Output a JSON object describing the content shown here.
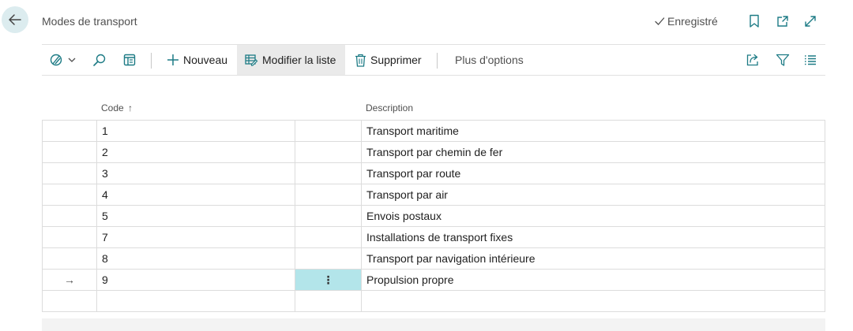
{
  "header": {
    "page_title": "Modes de transport",
    "saved_status": "Enregistré"
  },
  "actionbar": {
    "new_label": "Nouveau",
    "edit_list_label": "Modifier la liste",
    "delete_label": "Supprimer",
    "more_options_label": "Plus d'options"
  },
  "columns": {
    "code": "Code",
    "code_sort_indicator": "↑",
    "description": "Description"
  },
  "rows": [
    {
      "code": "1",
      "description": "Transport maritime"
    },
    {
      "code": "2",
      "description": "Transport par chemin de fer"
    },
    {
      "code": "3",
      "description": "Transport par route"
    },
    {
      "code": "4",
      "description": "Transport par air"
    },
    {
      "code": "5",
      "description": "Envois postaux"
    },
    {
      "code": "7",
      "description": "Installations de transport fixes"
    },
    {
      "code": "8",
      "description": "Transport par navigation intérieure"
    },
    {
      "code": "9",
      "description": "Propulsion propre",
      "selected": true,
      "row_indicator": "→",
      "menu_glyph": "⋮"
    }
  ],
  "colors": {
    "accent": "#1d7b85",
    "selected_cell": "#b3e5ea",
    "back_button_bg": "#dcecef"
  }
}
